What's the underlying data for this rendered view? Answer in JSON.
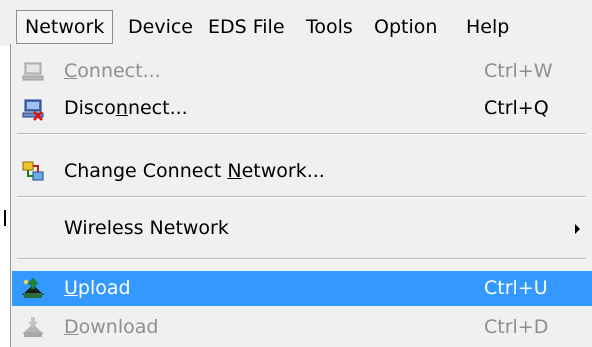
{
  "menubar": {
    "items": [
      {
        "label": "Network"
      },
      {
        "label": "Device"
      },
      {
        "label": "EDS File"
      },
      {
        "label": "Tools"
      },
      {
        "label": "Option"
      },
      {
        "label": "Help"
      }
    ]
  },
  "network_menu": {
    "items": [
      {
        "label_pre": "",
        "label_key": "C",
        "label_post": "onnect...",
        "shortcut": "Ctrl+W",
        "icon": "computer-icon",
        "enabled": false
      },
      {
        "label_pre": "Disco",
        "label_key": "n",
        "label_post": "nect...",
        "shortcut": "Ctrl+Q",
        "icon": "disconnect-icon",
        "enabled": true
      },
      {
        "label_pre": "Change Connect ",
        "label_key": "N",
        "label_post": "etwork...",
        "icon": "network-change-icon",
        "enabled": true
      },
      {
        "label_pre": "Wireless Network",
        "label_key": "",
        "label_post": "",
        "icon": "submenu-arrow-icon",
        "enabled": true
      },
      {
        "label_pre": "",
        "label_key": "U",
        "label_post": "pload",
        "shortcut": "Ctrl+U",
        "icon": "upload-icon",
        "enabled": true,
        "highlighted": true
      },
      {
        "label_pre": "",
        "label_key": "D",
        "label_post": "ownload",
        "shortcut": "Ctrl+D",
        "icon": "download-icon",
        "enabled": false
      }
    ]
  },
  "colors": {
    "menu_background": "#f0f0f0",
    "highlight": "#3399ff",
    "disabled_text": "#8f8f8f"
  }
}
